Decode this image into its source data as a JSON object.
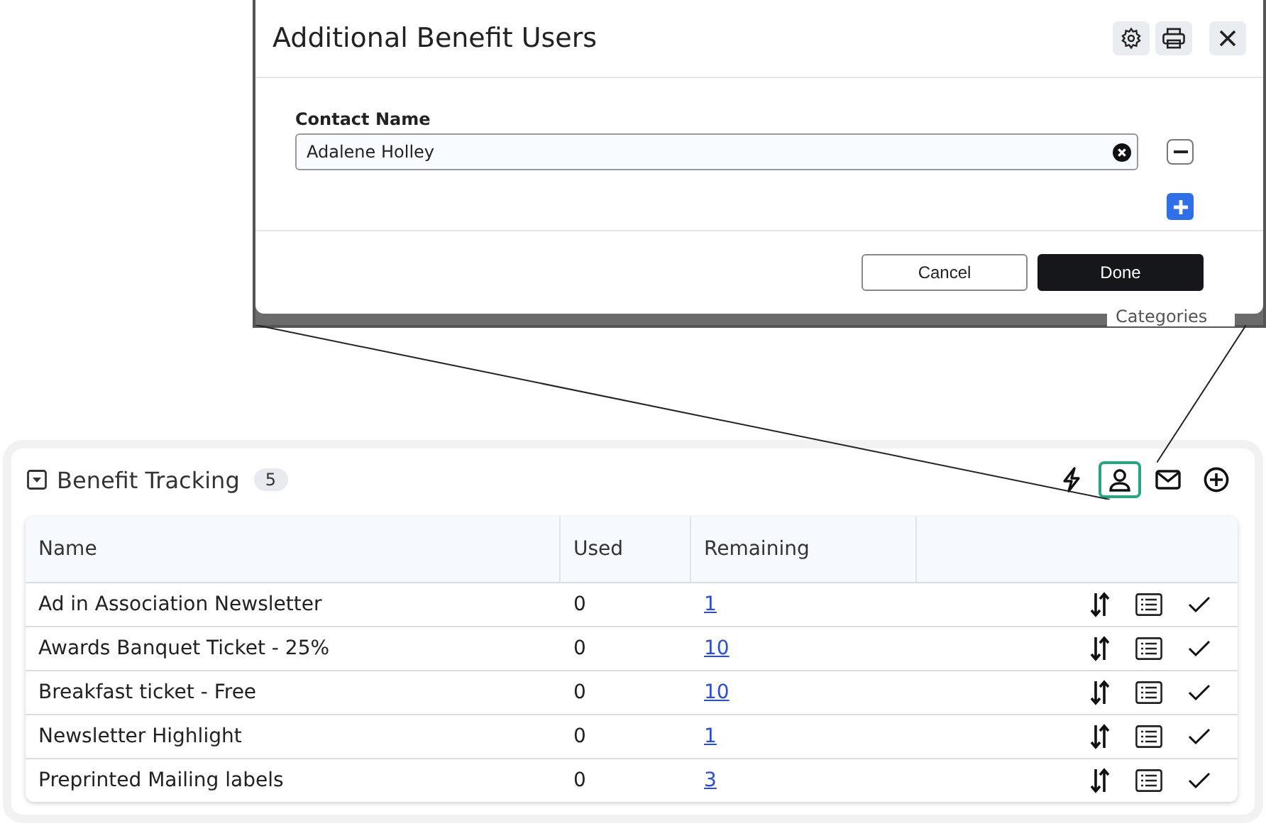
{
  "modal": {
    "title": "Additional Benefit Users",
    "field_label": "Contact Name",
    "field_value": "Adalene Holley",
    "buttons": [
      {
        "label": "Cancel",
        "kind": "secondary"
      },
      {
        "label": "Done",
        "kind": "primary"
      }
    ],
    "background_text": "Categories"
  },
  "panel": {
    "title": "Benefit Tracking",
    "count": "5",
    "expanded": true,
    "toolbar": [
      {
        "kind": "bolt",
        "selected": false
      },
      {
        "kind": "user",
        "selected": true
      },
      {
        "kind": "mail",
        "selected": false
      },
      {
        "kind": "plus",
        "selected": false
      }
    ]
  },
  "table": {
    "columns": [
      "Name",
      "Used",
      "Remaining"
    ],
    "rows": [
      {
        "name": "Ad in Association Newsletter",
        "used": "0",
        "remaining": "1"
      },
      {
        "name": "Awards Banquet Ticket - 25%",
        "used": "0",
        "remaining": "10"
      },
      {
        "name": "Breakfast ticket - Free",
        "used": "0",
        "remaining": "10"
      },
      {
        "name": "Newsletter Highlight",
        "used": "0",
        "remaining": "1"
      },
      {
        "name": "Preprinted Mailing labels",
        "used": "0",
        "remaining": "3"
      }
    ]
  }
}
